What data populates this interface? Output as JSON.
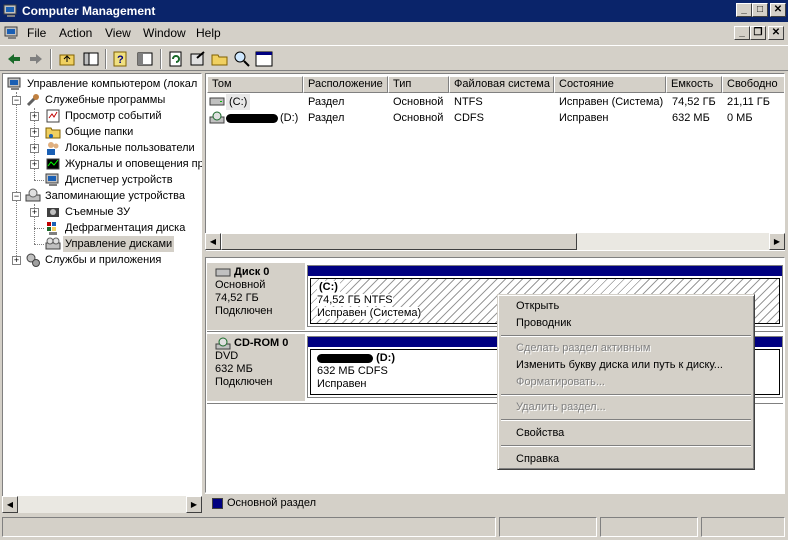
{
  "window": {
    "title": "Computer Management",
    "controls": {
      "minimize": "_",
      "maximize": "□",
      "close": "✕"
    },
    "mdi_controls": {
      "minimize": "_",
      "restore": "❐",
      "close": "✕"
    }
  },
  "menu": [
    "File",
    "Action",
    "View",
    "Window",
    "Help"
  ],
  "toolbar": [
    "back-icon",
    "forward-icon",
    "up-folder-icon",
    "show-tree-icon",
    "help-icon",
    "properties-icon",
    "refresh-icon",
    "export-icon",
    "open-folder-icon",
    "search-icon",
    "console-icon"
  ],
  "tree": {
    "root": "Управление компьютером (локал",
    "items": [
      {
        "label": "Служебные программы",
        "icon": "tools-icon"
      },
      {
        "label": "Просмотр событий",
        "icon": "event-viewer-icon"
      },
      {
        "label": "Общие папки",
        "icon": "shared-folders-icon"
      },
      {
        "label": "Локальные пользователи",
        "icon": "users-icon"
      },
      {
        "label": "Журналы и оповещения пр",
        "icon": "performance-logs-icon"
      },
      {
        "label": "Диспетчер устройств",
        "icon": "device-manager-icon"
      },
      {
        "label": "Запоминающие устройства",
        "icon": "storage-icon"
      },
      {
        "label": "Съемные ЗУ",
        "icon": "removable-storage-icon"
      },
      {
        "label": "Дефрагментация диска",
        "icon": "defrag-icon"
      },
      {
        "label": "Управление дисками",
        "icon": "disk-management-icon"
      },
      {
        "label": "Службы и приложения",
        "icon": "services-icon"
      }
    ]
  },
  "volume_table": {
    "columns": [
      "Том",
      "Расположение",
      "Тип",
      "Файловая система",
      "Состояние",
      "Емкость",
      "Свободно"
    ],
    "rows": [
      {
        "volume": "(C:)",
        "layout": "Раздел",
        "type": "Основной",
        "fs": "NTFS",
        "status": "Исправен (Система)",
        "capacity": "74,52 ГБ",
        "free": "21,11 ГБ"
      },
      {
        "volume": "(D:)",
        "layout": "Раздел",
        "type": "Основной",
        "fs": "CDFS",
        "status": "Исправен",
        "capacity": "632 МБ",
        "free": "0 МБ"
      }
    ]
  },
  "disks": [
    {
      "name": "Диск 0",
      "kind": "Основной",
      "size": "74,52 ГБ",
      "state": "Подключен",
      "part_label": "(C:)",
      "part_size": "74,52 ГБ NTFS",
      "part_status": "Исправен (Система)"
    },
    {
      "name": "CD-ROM 0",
      "kind": "DVD",
      "size": "632 МБ",
      "state": "Подключен",
      "part_label": "(D:)",
      "part_size": "632 МБ CDFS",
      "part_status": "Исправен"
    }
  ],
  "legend": {
    "label": "Основной раздел",
    "color": "#000080"
  },
  "context_menu": [
    {
      "label": "Открыть",
      "enabled": true
    },
    {
      "label": "Проводник",
      "enabled": true
    },
    {
      "label": "Сделать раздел активным",
      "enabled": false
    },
    {
      "label": "Изменить букву диска или путь к диску...",
      "enabled": true
    },
    {
      "label": "Форматировать...",
      "enabled": false
    },
    {
      "label": "Удалить раздел...",
      "enabled": false
    },
    {
      "label": "Свойства",
      "enabled": true
    },
    {
      "label": "Справка",
      "enabled": true
    }
  ],
  "colors": {
    "title_bar": "#0a246a",
    "partition_bar": "#000080",
    "face": "#d4d0c8"
  }
}
